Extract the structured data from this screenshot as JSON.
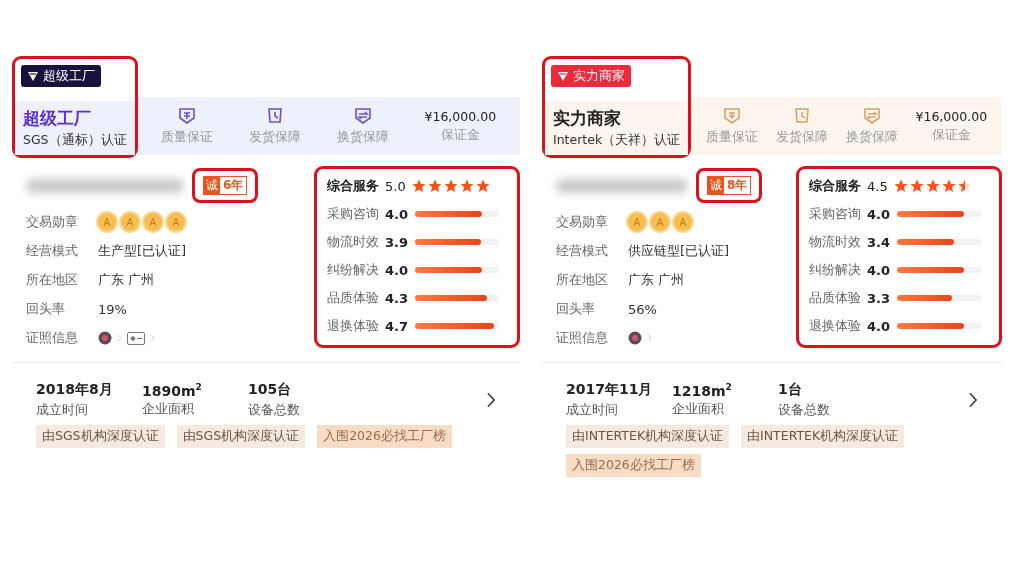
{
  "cards": [
    {
      "kind": "super_factory",
      "badge": {
        "label": "超级工厂"
      },
      "header_highlighted": true,
      "title": "超级工厂",
      "subtitle": "SGS（通标）认证",
      "guarantees": [
        "质量保证",
        "发货保障",
        "换货保障"
      ],
      "deposit": {
        "amount": "¥16,000.00",
        "label": "保证金"
      },
      "years": {
        "seal": "诚",
        "label": "6年",
        "highlighted": true
      },
      "info": [
        {
          "kind": "medals",
          "label": "交易勋章",
          "medals": [
            "A",
            "A",
            "A",
            "A"
          ]
        },
        {
          "kind": "text",
          "label": "经营模式",
          "value": "生产型[已认证]"
        },
        {
          "kind": "text",
          "label": "所在地区",
          "value": "广东 广州"
        },
        {
          "kind": "text",
          "label": "回头率",
          "value": "19%"
        },
        {
          "kind": "certs",
          "label": "证照信息",
          "certs": [
            {
              "kind": "seal"
            },
            {
              "kind": "license"
            }
          ]
        }
      ],
      "service": {
        "label": "综合服务",
        "score": "5.0",
        "stars": 5,
        "highlighted": true,
        "items": [
          {
            "label": "采购咨询",
            "score": "4.0",
            "level": 0.8
          },
          {
            "label": "物流时效",
            "score": "3.9",
            "level": 0.78
          },
          {
            "label": "纠纷解决",
            "score": "4.0",
            "level": 0.8
          },
          {
            "label": "品质体验",
            "score": "4.3",
            "level": 0.86
          },
          {
            "label": "退换体验",
            "score": "4.7",
            "level": 0.94
          }
        ]
      },
      "stats": [
        {
          "value": "2018年8月",
          "label": "成立时间"
        },
        {
          "value": "1890m$^{2}$",
          "label": "企业面积"
        },
        {
          "value": "105台",
          "label": "设备总数"
        }
      ],
      "tags": [
        "由SGS机构深度认证",
        "由SGS机构深度认证",
        "入围2026必找工厂榜"
      ]
    },
    {
      "kind": "strength_merchant",
      "badge": {
        "label": "实力商家"
      },
      "header_highlighted": true,
      "title": "实力商家",
      "subtitle": "Intertek（天祥）认证",
      "guarantees": [
        "质量保证",
        "发货保障",
        "换货保障"
      ],
      "deposit": {
        "amount": "¥16,000.00",
        "label": "保证金"
      },
      "years": {
        "seal": "诚",
        "label": "8年",
        "highlighted": true
      },
      "info": [
        {
          "kind": "medals",
          "label": "交易勋章",
          "medals": [
            "A",
            "A",
            "A"
          ]
        },
        {
          "kind": "text",
          "label": "经营模式",
          "value": "供应链型[已认证]"
        },
        {
          "kind": "text",
          "label": "所在地区",
          "value": "广东 广州"
        },
        {
          "kind": "text",
          "label": "回头率",
          "value": "56%"
        },
        {
          "kind": "certs",
          "label": "证照信息",
          "certs": [
            {
              "kind": "seal"
            }
          ]
        }
      ],
      "service": {
        "label": "综合服务",
        "score": "4.5",
        "stars": 4.5,
        "highlighted": true,
        "items": [
          {
            "label": "采购咨询",
            "score": "4.0",
            "level": 0.8
          },
          {
            "label": "物流时效",
            "score": "3.4",
            "level": 0.68
          },
          {
            "label": "纠纷解决",
            "score": "4.0",
            "level": 0.8
          },
          {
            "label": "品质体验",
            "score": "3.3",
            "level": 0.66
          },
          {
            "label": "退换体验",
            "score": "4.0",
            "level": 0.8
          }
        ]
      },
      "stats": [
        {
          "value": "2017年11月",
          "label": "成立时间"
        },
        {
          "value": "1218m$^{2}$",
          "label": "企业面积"
        },
        {
          "value": "1台",
          "label": "设备总数"
        }
      ],
      "tags": [
        "由INTERTEK机构深度认证",
        "由INTERTEK机构深度认证",
        "入围2026必找工厂榜"
      ]
    }
  ]
}
